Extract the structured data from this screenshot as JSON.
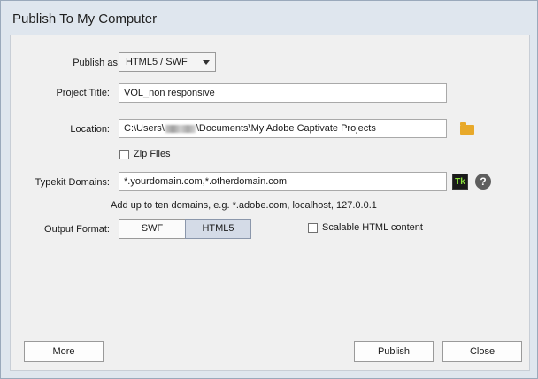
{
  "window": {
    "title": "Publish To My Computer"
  },
  "publish_as": {
    "label": "Publish as:",
    "value": "HTML5 / SWF"
  },
  "project_title": {
    "label": "Project Title:",
    "value": "VOL_non responsive"
  },
  "location": {
    "label": "Location:",
    "value_prefix": "C:\\Users\\",
    "value_suffix": "\\Documents\\My Adobe Captivate Projects",
    "icon": "folder-icon"
  },
  "zip_files": {
    "label": "Zip Files",
    "checked": false
  },
  "typekit": {
    "label": "Typekit Domains:",
    "value": "*.yourdomain.com,*.otherdomain.com",
    "tk_label": "Tk",
    "help_label": "?",
    "hint": "Add up to ten domains, e.g. *.adobe.com, localhost, 127.0.0.1"
  },
  "output_format": {
    "label": "Output Format:",
    "options": [
      "SWF",
      "HTML5"
    ],
    "selected": "HTML5"
  },
  "scalable_html": {
    "label": "Scalable HTML content",
    "checked": false
  },
  "buttons": {
    "more": "More",
    "publish": "Publish",
    "close": "Close"
  }
}
